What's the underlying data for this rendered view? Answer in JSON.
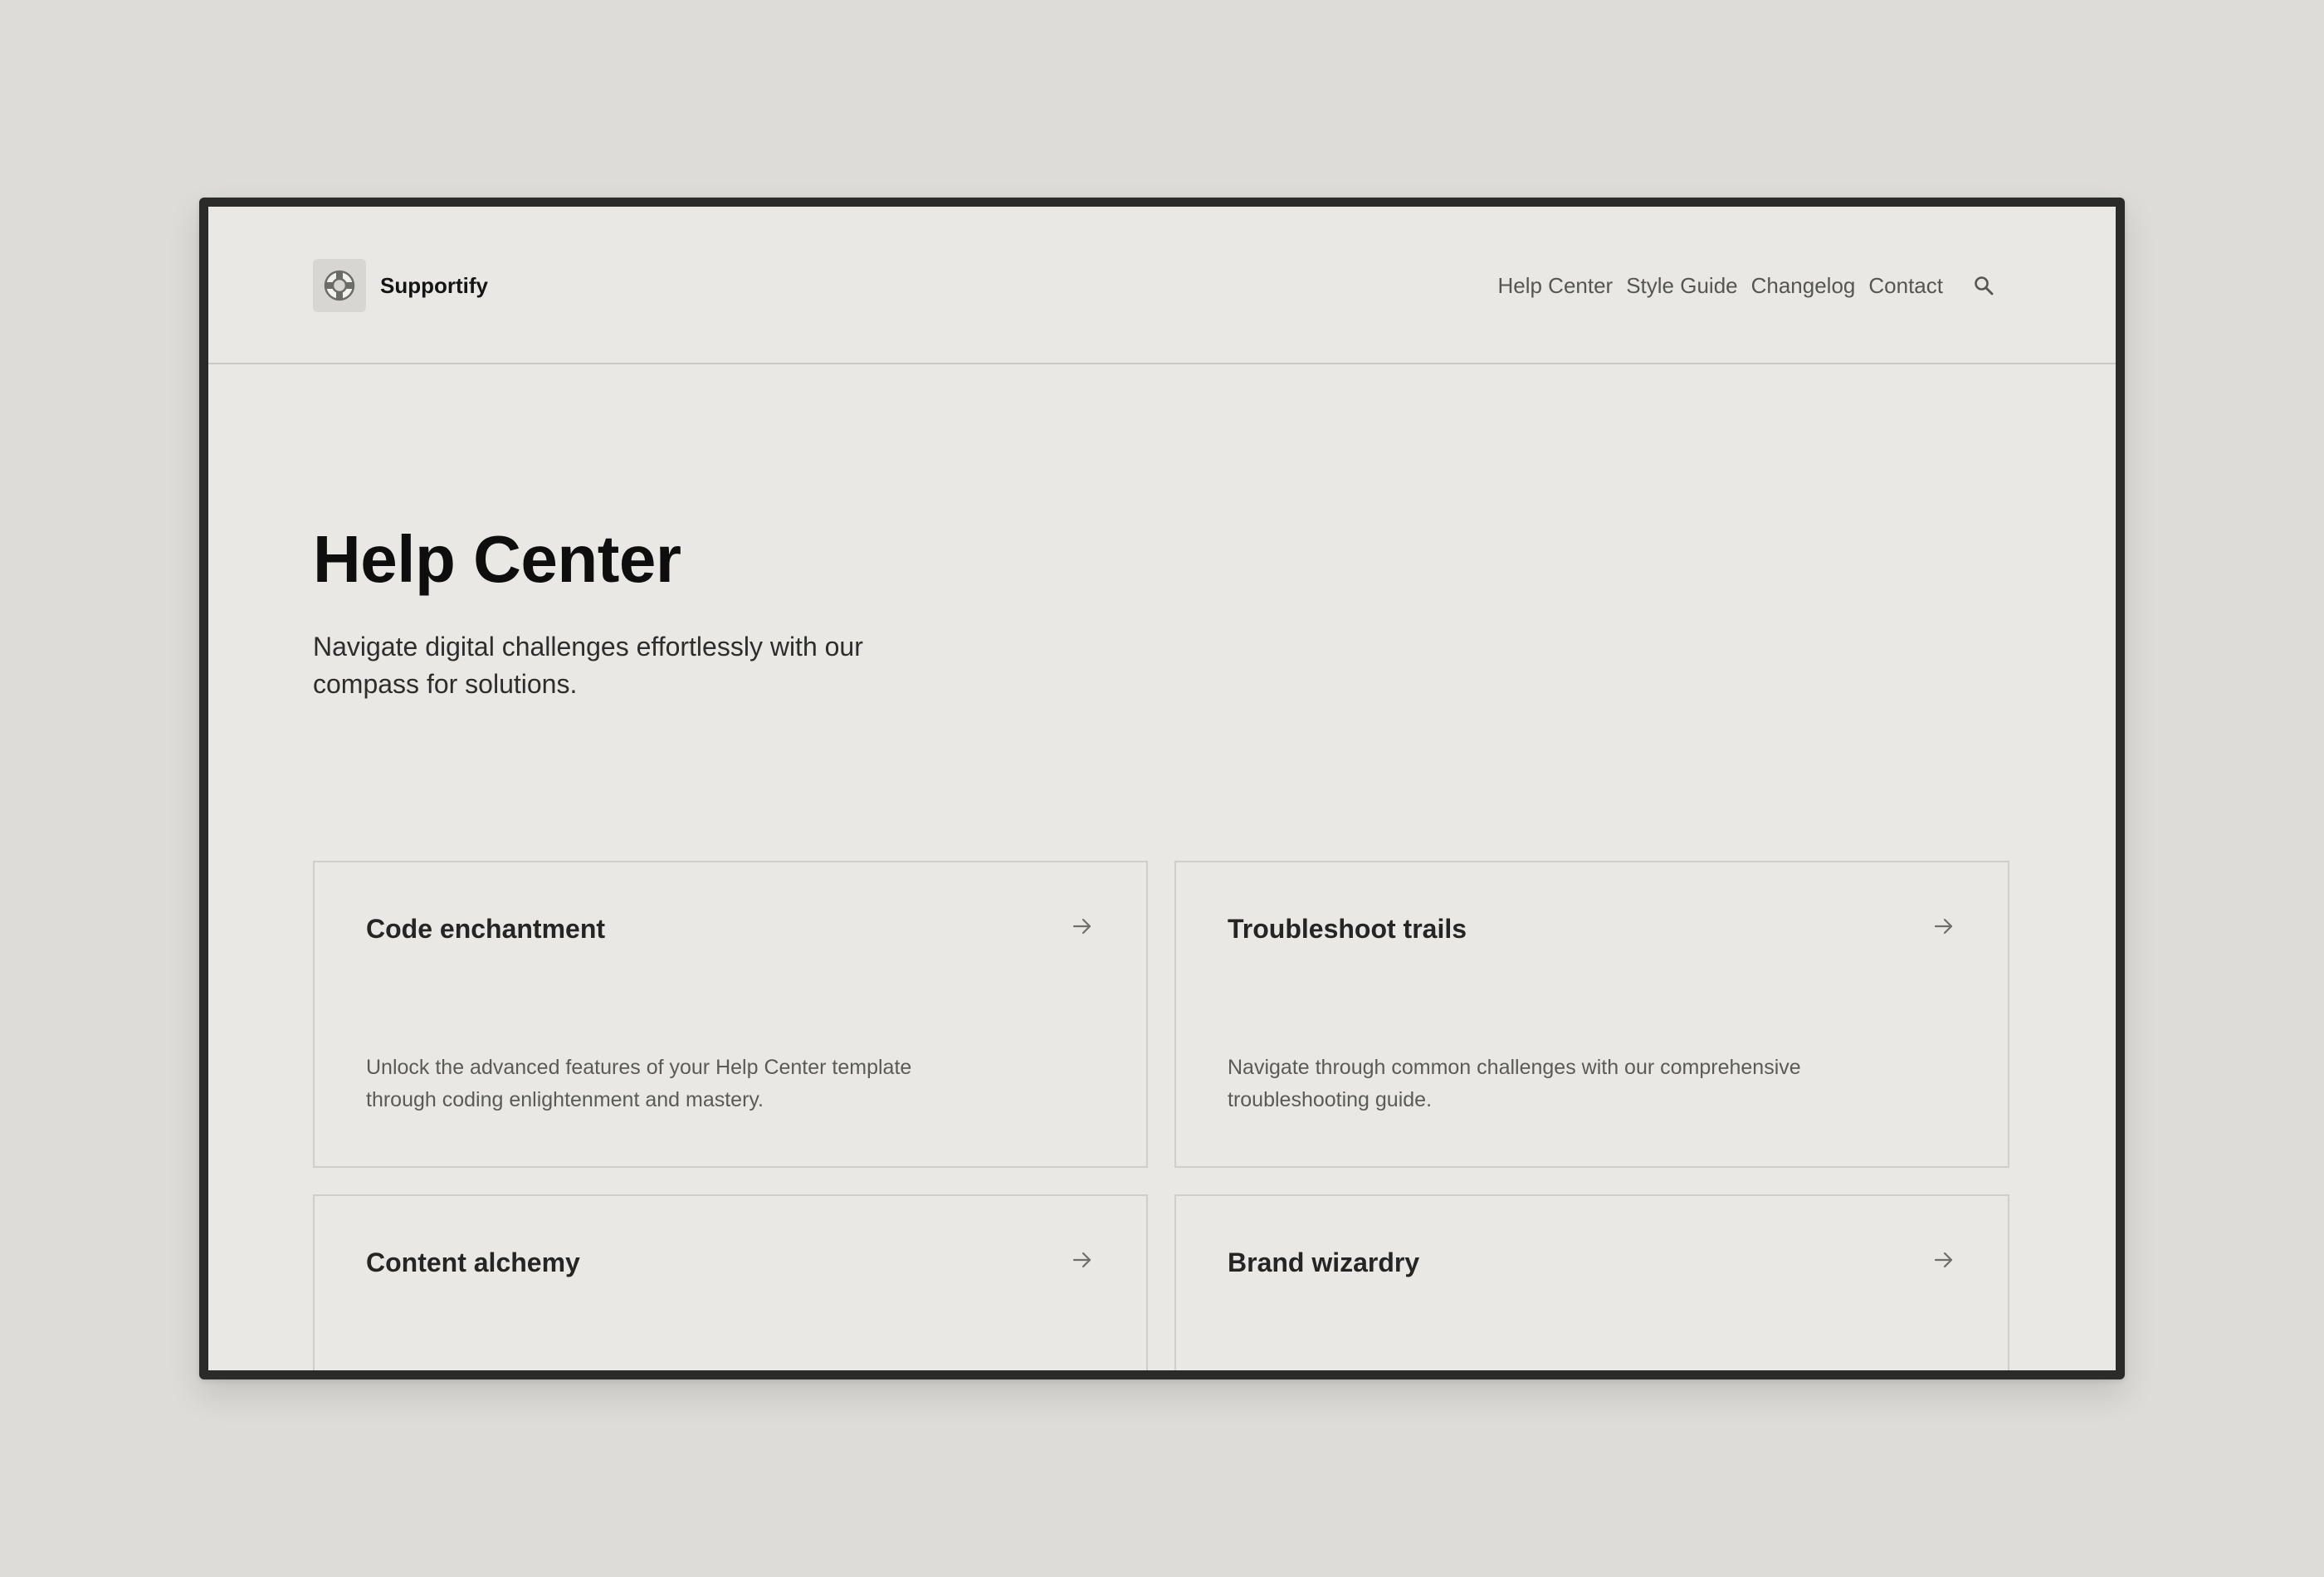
{
  "header": {
    "brand": "Supportify",
    "nav": [
      "Help Center",
      "Style Guide",
      "Changelog",
      "Contact"
    ]
  },
  "hero": {
    "title": "Help Center",
    "subtitle": "Navigate digital challenges effortlessly with our compass for solutions."
  },
  "cards": [
    {
      "title": "Code enchantment",
      "description": "Unlock the advanced features of your Help Center template through coding enlightenment and mastery."
    },
    {
      "title": "Troubleshoot trails",
      "description": "Navigate through common challenges with our comprehensive troubleshooting guide."
    },
    {
      "title": "Content alchemy",
      "description": ""
    },
    {
      "title": "Brand wizardry",
      "description": ""
    }
  ],
  "icons": {
    "logo": "lifebuoy-icon",
    "search": "search-icon",
    "card_arrow": "arrow-right-icon"
  },
  "colors": {
    "page_background": "#dddcd8",
    "screen_background": "#e9e8e4",
    "frame": "#2b2b29",
    "text_primary": "#0e0e0e",
    "text_muted": "#5a5a57",
    "border": "#cfcec9"
  }
}
